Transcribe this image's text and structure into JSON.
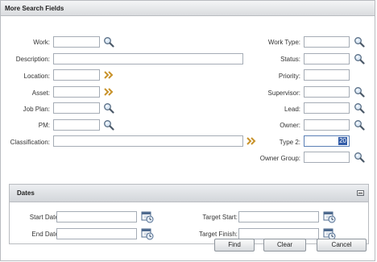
{
  "dialog": {
    "title": "More Search Fields"
  },
  "fields": {
    "work": {
      "label": "Work:",
      "value": ""
    },
    "description": {
      "label": "Description:",
      "value": ""
    },
    "location": {
      "label": "Location:",
      "value": ""
    },
    "asset": {
      "label": "Asset:",
      "value": ""
    },
    "job_plan": {
      "label": "Job Plan:",
      "value": ""
    },
    "pm": {
      "label": "PM:",
      "value": ""
    },
    "classification": {
      "label": "Classification:",
      "value": ""
    },
    "work_type": {
      "label": "Work Type:",
      "value": ""
    },
    "status": {
      "label": "Status:",
      "value": ""
    },
    "priority": {
      "label": "Priority:",
      "value": ""
    },
    "supervisor": {
      "label": "Supervisor:",
      "value": ""
    },
    "lead": {
      "label": "Lead:",
      "value": ""
    },
    "owner": {
      "label": "Owner:",
      "value": ""
    },
    "type2": {
      "label": "Type 2:",
      "value": "20"
    },
    "owner_group": {
      "label": "Owner Group:",
      "value": ""
    }
  },
  "dates": {
    "title": "Dates",
    "start_date": {
      "label": "Start Date:",
      "value": ""
    },
    "end_date": {
      "label": "End Date:",
      "value": ""
    },
    "target_start": {
      "label": "Target Start:",
      "value": ""
    },
    "target_finish": {
      "label": "Target Finish:",
      "value": ""
    }
  },
  "buttons": {
    "find": "Find",
    "clear": "Clear",
    "cancel": "Cancel"
  },
  "icons": {
    "lookup": "magnifier-icon",
    "detail_menu": "double-chevron-icon",
    "calendar": "calendar-clock-icon"
  },
  "colors": {
    "selection": "#2f5aa7",
    "accent_icon": "#c8922a"
  }
}
